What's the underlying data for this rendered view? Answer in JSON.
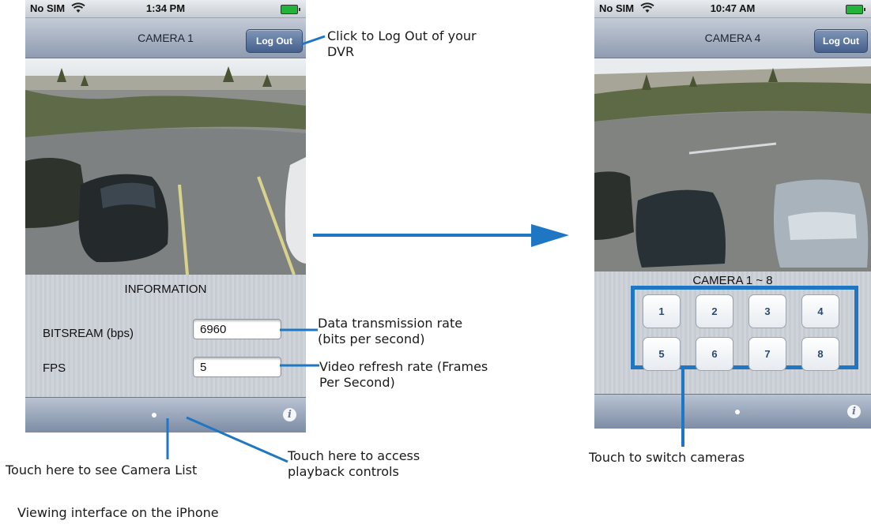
{
  "left_phone": {
    "status": {
      "carrier": "No SIM",
      "time": "1:34 PM"
    },
    "nav": {
      "title": "CAMERA 1",
      "logout_label": "Log Out"
    },
    "info": {
      "heading": "INFORMATION",
      "bitrate_label": "BITSREAM (bps)",
      "bitrate_value": "6960",
      "fps_label": "FPS",
      "fps_value": "5"
    },
    "page_dots_active": 1,
    "info_icon": "i"
  },
  "right_phone": {
    "status": {
      "carrier": "No SIM",
      "time": "10:47 AM"
    },
    "nav": {
      "title": "CAMERA 4",
      "logout_label": "Log Out"
    },
    "camera_range_label": "CAMERA 1 ~ 8",
    "camera_buttons": [
      "1",
      "2",
      "3",
      "4",
      "5",
      "6",
      "7",
      "8"
    ],
    "page_dots_active": 2,
    "info_icon": "i"
  },
  "annotations": {
    "logout": "Click to Log Out of your DVR",
    "bitrate": "Data transmission rate (bits per second)",
    "fps": "Video refresh rate (Frames Per Second)",
    "camera_list": "Touch here to see Camera List",
    "playback": "Touch here to access playback controls",
    "switch": "Touch to switch cameras",
    "caption": "Viewing interface on the iPhone"
  },
  "colors": {
    "callout_line": "#1f77c4",
    "highlight_box": "#1f77c4",
    "arrow": "#1f77c4"
  },
  "icons": [
    "wifi-icon",
    "battery-icon",
    "info-icon",
    "arrow-right-icon"
  ]
}
